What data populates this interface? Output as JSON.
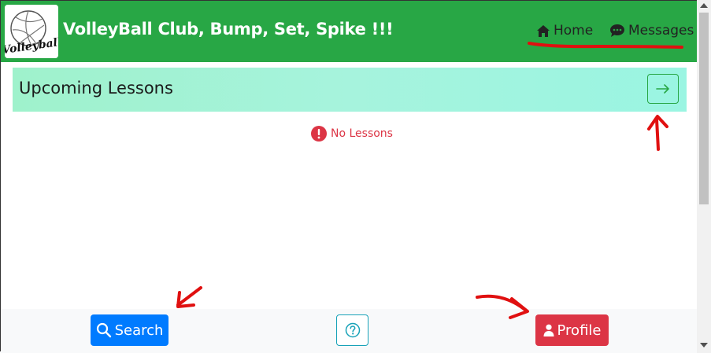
{
  "navbar": {
    "brand": "VolleyBall Club, Bump, Set, Spike !!!",
    "logo_text": "Volleyball",
    "links": [
      {
        "label": "Home",
        "icon": "home-icon"
      },
      {
        "label": "Messages",
        "icon": "chat-bubble-icon"
      }
    ],
    "background": "#28a745"
  },
  "banner": {
    "title": "Upcoming Lessons",
    "action_icon": "arrow-right-icon"
  },
  "status": {
    "message": "No Lessons",
    "icon": "exclamation-circle-icon",
    "color": "#dc3545"
  },
  "bottom_bar": {
    "search_label": "Search",
    "search_icon": "search-icon",
    "help_icon": "question-circle-icon",
    "profile_label": "Profile",
    "profile_icon": "person-icon"
  },
  "colors": {
    "primary": "#007bff",
    "danger": "#dc3545",
    "info": "#17a2b8",
    "success": "#28a745"
  }
}
